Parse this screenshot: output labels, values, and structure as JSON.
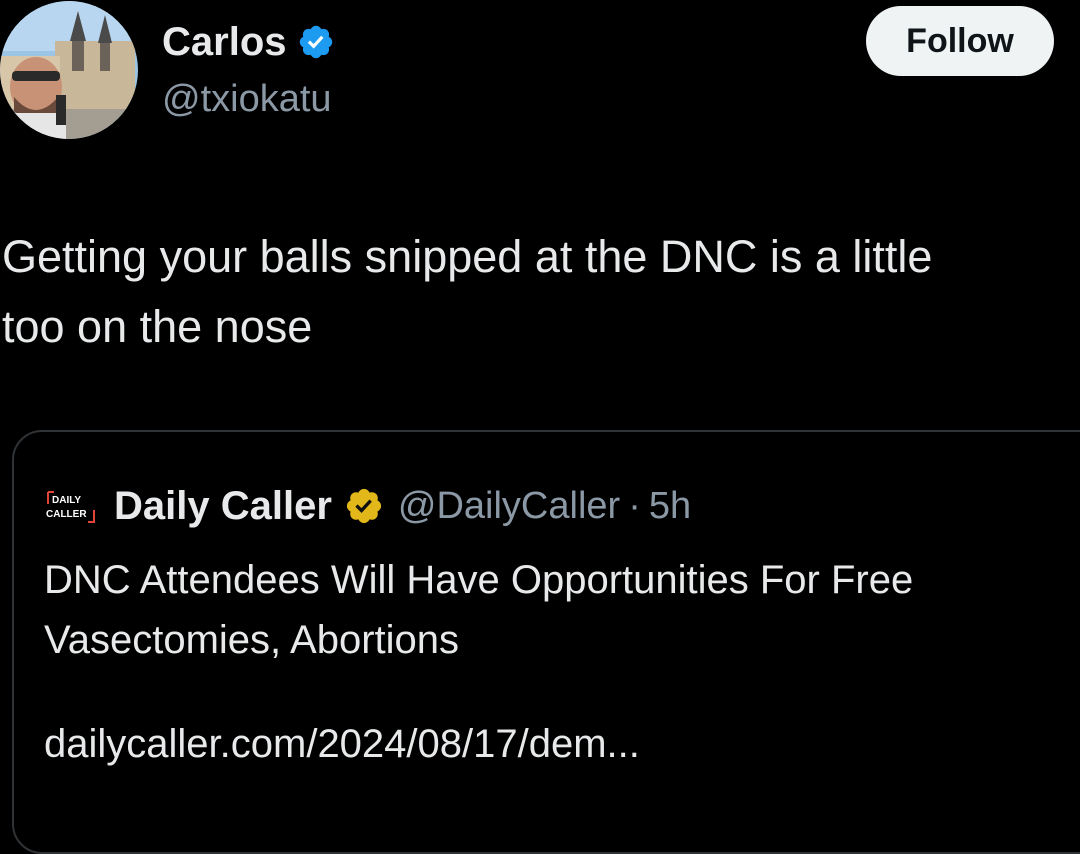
{
  "author": {
    "name": "Carlos",
    "handle": "@txiokatu",
    "verified": "blue",
    "avatar_icon": "avatar-photo"
  },
  "follow_label": "Follow",
  "tweet": {
    "line1": "Getting your balls snipped at the DNC is a little",
    "line2": "too on the nose"
  },
  "quote": {
    "logo": "daily-caller-logo",
    "name": "Daily Caller",
    "verified": "gold",
    "handle": "@DailyCaller",
    "separator": "·",
    "time": "5h",
    "text_line1": "DNC Attendees Will Have Opportunities For Free",
    "text_line2": "Vasectomies, Abortions",
    "link": "dailycaller.com/2024/08/17/dem..."
  },
  "colors": {
    "background": "#000000",
    "text": "#e7e9ea",
    "muted": "#8b98a5",
    "verified_blue": "#1d9bf0",
    "verified_gold": "#e2b719",
    "follow_bg": "#eff3f4"
  }
}
